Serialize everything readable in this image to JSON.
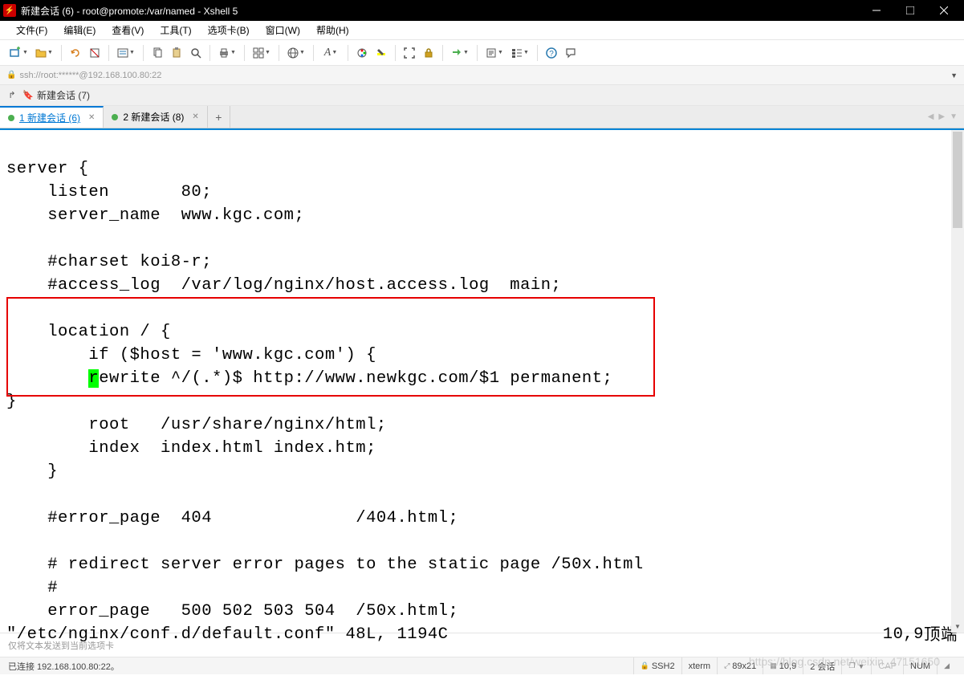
{
  "titlebar": {
    "title": "新建会话 (6) - root@promote:/var/named - Xshell 5"
  },
  "menu": {
    "file": "文件(F)",
    "edit": "编辑(E)",
    "view": "查看(V)",
    "tools": "工具(T)",
    "tab": "选项卡(B)",
    "window": "窗口(W)",
    "help": "帮助(H)"
  },
  "addressbar": {
    "text": "ssh://root:******@192.168.100.80:22"
  },
  "sessionbar": {
    "label": "新建会话 (7)"
  },
  "tabs": {
    "t1": "1 新建会话 (6)",
    "t2": "2 新建会话 (8)"
  },
  "terminal": {
    "l01": "server {",
    "l02": "    listen       80;",
    "l03": "    server_name  www.kgc.com;",
    "l04": "",
    "l05": "    #charset koi8-r;",
    "l06": "    #access_log  /var/log/nginx/host.access.log  main;",
    "l07": "",
    "l08": "    location / {",
    "l09": "        if ($host = 'www.kgc.com') {",
    "l10a": "        ",
    "l10b": "r",
    "l10c": "ewrite ^/(.*)$ http://www.newkgc.com/$1 permanent;",
    "l11": "}",
    "l12": "        root   /usr/share/nginx/html;",
    "l13": "        index  index.html index.htm;",
    "l14": "    }",
    "l15": "",
    "l16": "    #error_page  404              /404.html;",
    "l17": "",
    "l18": "    # redirect server error pages to the static page /50x.html",
    "l19": "    #",
    "l20": "    error_page   500 502 503 504  /50x.html;",
    "l21a": "\"/etc/nginx/conf.d/default.conf\" 48L, 1194C",
    "l21b": "10,9",
    "l21c": "顶端"
  },
  "footer": {
    "text": "仅将文本发送到当前选项卡"
  },
  "status": {
    "connected": "已连接 192.168.100.80:22。",
    "ssh": "SSH2",
    "term": "xterm",
    "size": "89x21",
    "pos": "10,9",
    "sessions": "2 会话",
    "cap": "CAP",
    "num": "NUM"
  },
  "watermark": "https://blog.csdn.net/weixin_47151650"
}
